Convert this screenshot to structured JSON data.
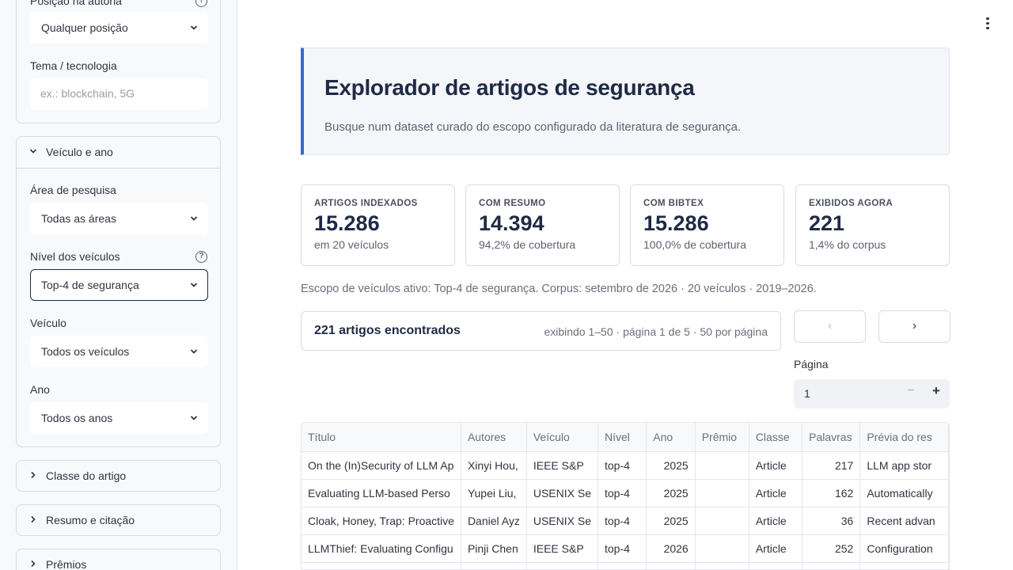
{
  "sidebar": {
    "author_position": {
      "label": "Posição na autoria",
      "value": "Qualquer posição"
    },
    "topic": {
      "label": "Tema / tecnologia",
      "placeholder": "ex.: blockchain, 5G"
    },
    "venue_year_section": {
      "title": "Veículo e ano",
      "research_area": {
        "label": "Área de pesquisa",
        "value": "Todas as áreas"
      },
      "venue_tier": {
        "label": "Nível dos veículos",
        "value": "Top-4 de segurança"
      },
      "venue": {
        "label": "Veículo",
        "value": "Todos os veículos"
      },
      "year": {
        "label": "Ano",
        "value": "Todos os anos"
      }
    },
    "collapsed_sections": [
      {
        "title": "Classe do artigo"
      },
      {
        "title": "Resumo e citação"
      },
      {
        "title": "Prêmios"
      }
    ]
  },
  "hero": {
    "title": "Explorador de artigos de segurança",
    "subtitle": "Busque num dataset curado do escopo configurado da literatura de segurança."
  },
  "stats": [
    {
      "label": "ARTIGOS INDEXADOS",
      "value": "15.286",
      "sub": "em 20 veículos"
    },
    {
      "label": "COM RESUMO",
      "value": "14.394",
      "sub": "94,2% de cobertura"
    },
    {
      "label": "COM BIBTEX",
      "value": "15.286",
      "sub": "100,0% de cobertura"
    },
    {
      "label": "EXIBIDOS AGORA",
      "value": "221",
      "sub": "1,4% do corpus"
    }
  ],
  "scope_text": "Escopo de veículos ativo: Top-4 de segurança. Corpus: setembro de 2026 · 20 veículos · 2019–2026.",
  "results": {
    "count_text": "221 artigos encontrados",
    "info_text": "exibindo 1–50 · página 1 de 5 · 50 por página"
  },
  "pagination": {
    "prev_label": "‹",
    "next_label": "›",
    "page_label": "Página",
    "page_value": "1",
    "minus_label": "−",
    "plus_label": "+"
  },
  "table": {
    "columns": [
      "Título",
      "Autores",
      "Veículo",
      "Nível",
      "Ano",
      "Prêmio",
      "Classe",
      "Palavras",
      "Prévia do res"
    ],
    "rows": [
      [
        "On the (In)Security of LLM Ap",
        "Xinyi Hou,",
        "IEEE S&P",
        "top-4",
        "2025",
        "",
        "Article",
        "217",
        "LLM app stor"
      ],
      [
        "Evaluating LLM-based Perso",
        "Yupei Liu,",
        "USENIX Se",
        "top-4",
        "2025",
        "",
        "Article",
        "162",
        "Automatically"
      ],
      [
        "Cloak, Honey, Trap: Proactive",
        "Daniel Ayz",
        "USENIX Se",
        "top-4",
        "2025",
        "",
        "Article",
        "36",
        "Recent advan"
      ],
      [
        "LLMThief: Evaluating Configu",
        "Pinji Chen",
        "IEEE S&P",
        "top-4",
        "2026",
        "",
        "Article",
        "252",
        "Configuration"
      ],
      [
        "",
        "",
        "",
        "",
        "",
        "",
        "",
        "",
        ""
      ]
    ]
  },
  "icons": {
    "chevron_down": "chevron-down-icon",
    "chevron_right": "chevron-right-icon",
    "help": "help-circle-icon",
    "menu": "kebab-menu-icon"
  },
  "colors": {
    "accent": "#3c6bc4",
    "focus_border": "#1b2a48",
    "heading": "#1f2a44"
  }
}
